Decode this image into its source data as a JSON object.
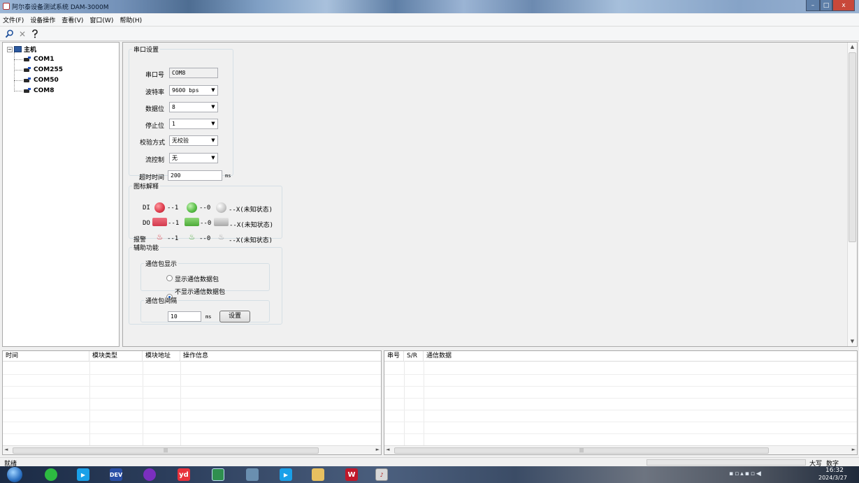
{
  "window": {
    "title": "阿尔泰设备测试系统 DAM-3000M",
    "min": "–",
    "max": "□",
    "close": "x"
  },
  "menu": [
    "文件(F)",
    "设备操作",
    "查看(V)",
    "窗口(W)",
    "帮助(H)"
  ],
  "tree": {
    "root": "主机",
    "expander": "−",
    "items": [
      "COM1",
      "COM255",
      "COM50",
      "COM8"
    ]
  },
  "serial": {
    "legend": "串口设置",
    "port_label": "串口号",
    "port_value": "COM8",
    "baud_label": "波特率",
    "baud_value": "9600 bps",
    "databits_label": "数据位",
    "databits_value": "8",
    "stopbits_label": "停止位",
    "stopbits_value": "1",
    "parity_label": "校验方式",
    "parity_value": "无校验",
    "flow_label": "流控制",
    "flow_value": "无",
    "timeout_label": "超时时间",
    "timeout_value": "200",
    "timeout_unit": "ms"
  },
  "legend_panel": {
    "legend": "图标解释",
    "di": "DI",
    "do": "DO",
    "alarm": "报警",
    "v1": "--1",
    "v0": "--0",
    "vx": "--X(未知状态)",
    "colors": {
      "red": "#e04050",
      "green": "#5cc04a",
      "gray": "#c8c8c8"
    }
  },
  "aux": {
    "legend": "辅助功能",
    "display_legend": "通信包显示",
    "show_label": "显示通信数据包",
    "hide_label": "不显示通信数据包",
    "selected": "hide",
    "interval_legend": "通信包间隔",
    "interval_value": "10",
    "interval_unit": "ms",
    "set_button": "设置"
  },
  "log_table": {
    "columns": [
      "时间",
      "模块类型",
      "模块地址",
      "操作信息"
    ]
  },
  "comm_table": {
    "columns": [
      "串号",
      "S/R",
      "通信数据"
    ]
  },
  "status": {
    "ready": "就绪",
    "caps": "大写",
    "num": "数字"
  },
  "clock": {
    "time": "16:32",
    "date": "2024/3/27"
  },
  "taskbar_apps": [
    "DEV",
    "yd"
  ]
}
